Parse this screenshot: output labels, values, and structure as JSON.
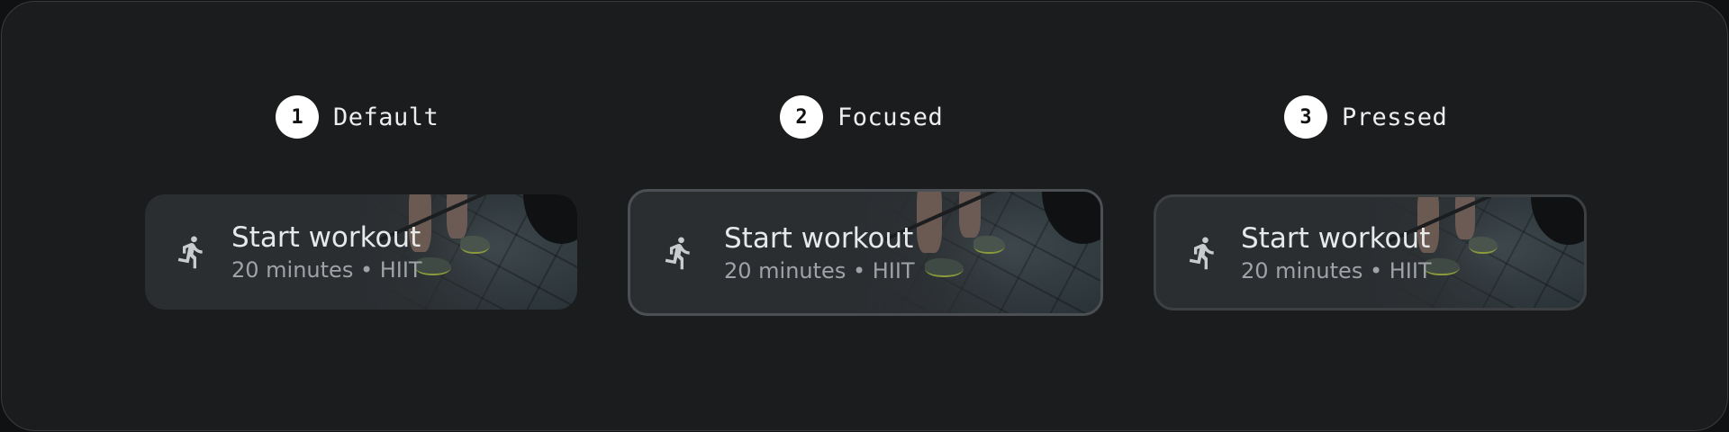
{
  "states": [
    {
      "number": "1",
      "label": "Default"
    },
    {
      "number": "2",
      "label": "Focused"
    },
    {
      "number": "3",
      "label": "Pressed"
    }
  ],
  "chip": {
    "title": "Start workout",
    "subtitle": "20 minutes • HIIT",
    "icon": "directions-run-icon"
  },
  "colors": {
    "background": "#1b1c1e",
    "chip": "#2b2e31",
    "badge": "#ffffff",
    "label": "#eceef0",
    "focus_border": "#4c4f53"
  }
}
